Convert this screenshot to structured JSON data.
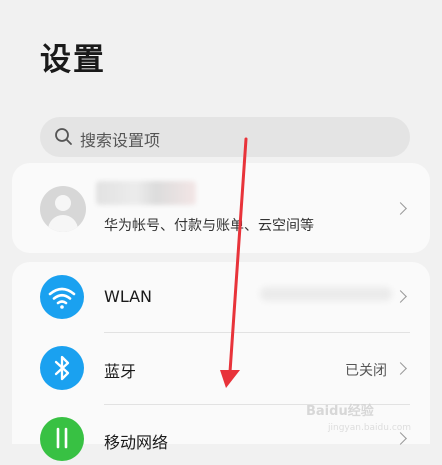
{
  "page": {
    "title": "设置"
  },
  "search": {
    "placeholder": "搜索设置项"
  },
  "account": {
    "subtitle": "华为帐号、付款与账单、云空间等"
  },
  "settings": [
    {
      "label": "WLAN",
      "value": "",
      "icon": "wifi-icon",
      "color": "#1aa1f0"
    },
    {
      "label": "蓝牙",
      "value": "已关闭",
      "icon": "bluetooth-icon",
      "color": "#1aa1f0"
    },
    {
      "label": "移动网络",
      "value": "",
      "icon": "mobile-network-icon",
      "color": "#38c143"
    }
  ],
  "colors": {
    "accent_blue": "#1aa1f0",
    "accent_green": "#38c143",
    "annotation_red": "#e8333a"
  },
  "watermark": {
    "text": "Baidu经验",
    "url": "jingyan.baidu.com"
  }
}
